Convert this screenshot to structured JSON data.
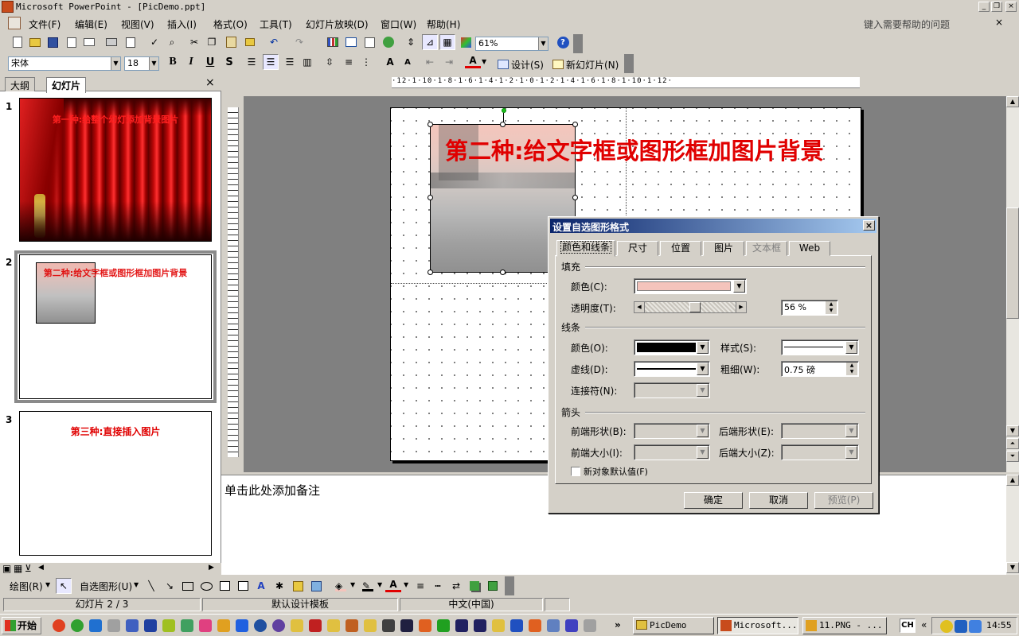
{
  "window": {
    "title": "Microsoft PowerPoint - [PicDemo.ppt]"
  },
  "menu": {
    "items": [
      "文件(F)",
      "编辑(E)",
      "视图(V)",
      "插入(I)",
      "格式(O)",
      "工具(T)",
      "幻灯片放映(D)",
      "窗口(W)",
      "帮助(H)"
    ],
    "help_placeholder": "键入需要帮助的问题"
  },
  "toolbar": {
    "zoom": "61%"
  },
  "format_toolbar": {
    "font": "宋体",
    "size": "18",
    "bold": "B",
    "italic": "I",
    "underline": "U",
    "shadow": "S",
    "design_label": "设计(S)",
    "new_slide_label": "新幻灯片(N)"
  },
  "left_panel": {
    "tabs": [
      "大纲",
      "幻灯片"
    ],
    "close": "×",
    "slides": [
      {
        "num": "1",
        "title": "第一种:给整个幻灯添加背景图片"
      },
      {
        "num": "2",
        "title": "第二种:给文字框或图形框加图片背景"
      },
      {
        "num": "3",
        "title": "第三种:直接插入图片"
      }
    ]
  },
  "ruler": {
    "h": "·12·1·10·1·8·1·6·1·4·1·2·1·0·1·2·1·4·1·6·1·8·1·10·1·12·"
  },
  "slide": {
    "title": "第二种:给文字框或图形框加图片背景"
  },
  "notes": {
    "placeholder": "单击此处添加备注"
  },
  "dialog": {
    "title": "设置自选图形格式",
    "close": "×",
    "tabs": [
      "颜色和线条",
      "尺寸",
      "位置",
      "图片",
      "文本框",
      "Web"
    ],
    "fill": {
      "section": "填充",
      "color_label": "颜色(C):",
      "transparency_label": "透明度(T):",
      "transparency_value": "56 %",
      "transparency_fraction": 0.56
    },
    "line": {
      "section": "线条",
      "color_label": "颜色(O):",
      "style_label": "样式(S):",
      "dash_label": "虚线(D):",
      "weight_label": "粗细(W):",
      "weight_value": "0.75 磅",
      "connector_label": "连接符(N):"
    },
    "arrows": {
      "section": "箭头",
      "begin_style": "前端形状(B):",
      "end_style": "后端形状(E):",
      "begin_size": "前端大小(I):",
      "end_size": "后端大小(Z):"
    },
    "default_checkbox": "新对象默认值(F)",
    "buttons": {
      "ok": "确定",
      "cancel": "取消",
      "preview": "预览(P)"
    }
  },
  "draw_toolbar": {
    "draw": "绘图(R)",
    "autoshapes": "自选图形(U)"
  },
  "status": {
    "slide": "幻灯片 2 / 3",
    "template": "默认设计模板",
    "language": "中文(中国)"
  },
  "taskbar": {
    "start": "开始",
    "tasks": [
      "PicDemo",
      "Microsoft...",
      "11.PNG - ..."
    ],
    "ime": "CH",
    "time": "14:55"
  }
}
